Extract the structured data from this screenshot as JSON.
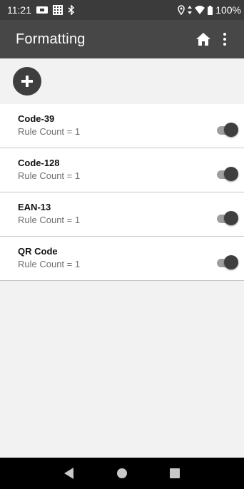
{
  "status_bar": {
    "time": "11:21",
    "battery_percent": "100%",
    "left_icons": [
      "notification-card-icon",
      "keyboard-grid-icon",
      "bluetooth-icon"
    ],
    "right_icons": [
      "location-icon",
      "data-arrows-icon",
      "wifi-icon",
      "battery-icon"
    ]
  },
  "app_bar": {
    "title": "Formatting",
    "actions": [
      "home-icon",
      "overflow-menu-icon"
    ]
  },
  "add_button": {
    "icon": "plus-icon"
  },
  "formats": [
    {
      "title": "Code-39",
      "subtitle": "Rule Count = 1",
      "enabled": true
    },
    {
      "title": "Code-128",
      "subtitle": "Rule Count = 1",
      "enabled": true
    },
    {
      "title": "EAN-13",
      "subtitle": "Rule Count = 1",
      "enabled": true
    },
    {
      "title": "QR Code",
      "subtitle": "Rule Count = 1",
      "enabled": true
    }
  ],
  "nav_bar": {
    "buttons": [
      "back-icon",
      "home-circle-icon",
      "recents-icon"
    ]
  },
  "colors": {
    "status_bar": "#3b3b3b",
    "app_bar": "#474747",
    "background": "#f2f2f2",
    "switch_thumb": "#3f3f3f",
    "switch_track": "#9e9e9e"
  }
}
